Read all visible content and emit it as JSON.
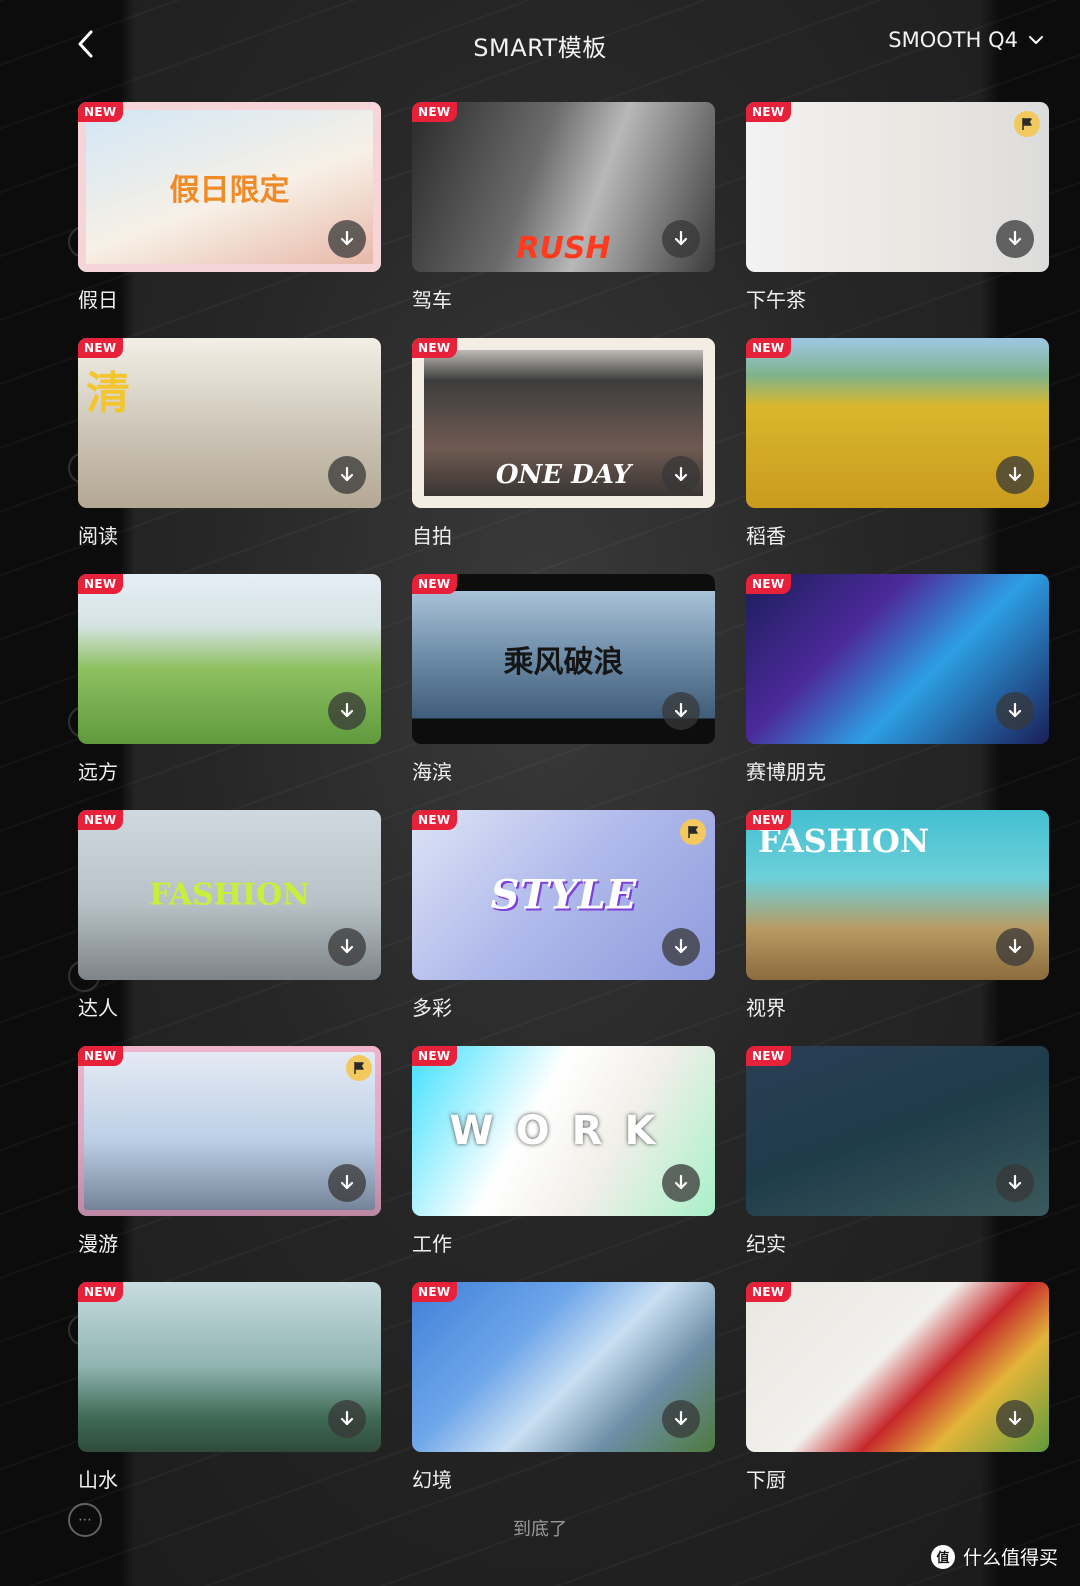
{
  "header": {
    "title": "SMART模板",
    "back_icon": "chevron-left-icon",
    "device_select": {
      "value": "SMOOTH Q4",
      "icon": "chevron-down-icon"
    }
  },
  "colors": {
    "background": "#141414",
    "new_badge": "#e8213b",
    "pro_badge": "#f3c95f",
    "text": "#f0f0f0",
    "muted_text": "#9a9a9a"
  },
  "badge_text": "NEW",
  "templates": [
    {
      "label": "假日",
      "title_text": "假日限定",
      "new": true,
      "pro": false
    },
    {
      "label": "驾车",
      "title_text": "RUSH",
      "new": true,
      "pro": false
    },
    {
      "label": "下午茶",
      "title_text": "",
      "new": true,
      "pro": true
    },
    {
      "label": "阅读",
      "title_text": "清",
      "new": true,
      "pro": false
    },
    {
      "label": "自拍",
      "title_text": "ONE DAY",
      "new": true,
      "pro": false
    },
    {
      "label": "稻香",
      "title_text": "",
      "new": true,
      "pro": false
    },
    {
      "label": "远方",
      "title_text": "",
      "new": true,
      "pro": false
    },
    {
      "label": "海滨",
      "title_text": "乘风破浪",
      "new": true,
      "pro": false
    },
    {
      "label": "赛博朋克",
      "title_text": "",
      "new": true,
      "pro": false
    },
    {
      "label": "达人",
      "title_text": "FASHION",
      "new": true,
      "pro": false
    },
    {
      "label": "多彩",
      "title_text": "STYLE",
      "new": true,
      "pro": true
    },
    {
      "label": "视界",
      "title_text": "FASHION",
      "new": true,
      "pro": false
    },
    {
      "label": "漫游",
      "title_text": "",
      "new": true,
      "pro": true
    },
    {
      "label": "工作",
      "title_text": "WORK",
      "new": true,
      "pro": false
    },
    {
      "label": "纪实",
      "title_text": "",
      "new": true,
      "pro": false
    },
    {
      "label": "山水",
      "title_text": "",
      "new": true,
      "pro": false
    },
    {
      "label": "幻境",
      "title_text": "",
      "new": true,
      "pro": false
    },
    {
      "label": "下厨",
      "title_text": "",
      "new": true,
      "pro": false
    }
  ],
  "footer": {
    "end_text": "到底了"
  },
  "watermark": {
    "logo_text": "值",
    "text": "什么值得买"
  }
}
